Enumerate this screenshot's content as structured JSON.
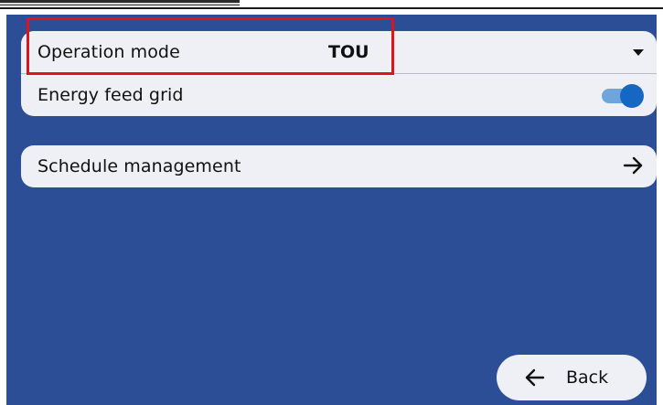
{
  "settings": {
    "operation_mode_label": "Operation mode",
    "operation_mode_value": "TOU",
    "energy_feed_grid_label": "Energy feed grid",
    "energy_feed_grid_enabled": true
  },
  "schedule": {
    "label": "Schedule management"
  },
  "back": {
    "label": "Back"
  },
  "colors": {
    "screen_background": "#2c4e97",
    "card_background": "#eef0f5",
    "toggle_on": "#1667c4",
    "highlight": "#e0121c"
  },
  "icons": {
    "dropdown": "chevron-down-icon",
    "schedule_arrow": "arrow-right-icon",
    "back_arrow": "arrow-left-icon"
  }
}
